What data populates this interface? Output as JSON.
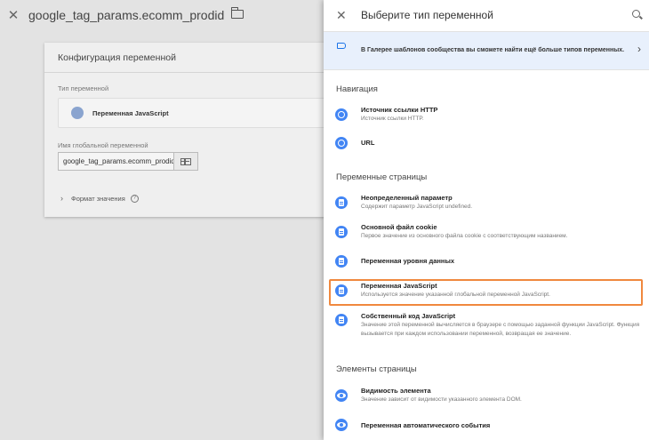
{
  "editor": {
    "title": "google_tag_params.ecomm_prodid",
    "card_title": "Конфигурация переменной",
    "type_label": "Тип переменной",
    "type_value": "Переменная JavaScript",
    "global_var_label": "Имя глобальной переменной",
    "global_var_value": "google_tag_params.ecomm_prodid",
    "format_label": "Формат значения",
    "help_glyph": "?"
  },
  "panel": {
    "title": "Выберите тип переменной",
    "promo": "В Галерее шаблонов сообщества вы сможете найти ещё больше типов переменных.",
    "sections": {
      "navigation": "Навигация",
      "page_vars": "Переменные страницы",
      "page_elements": "Элементы страницы"
    },
    "items": {
      "referrer_title": "Источник ссылки HTTP",
      "referrer_desc": "Источник ссылки HTTP.",
      "url_title": "URL",
      "undefined_title": "Неопределенный параметр",
      "undefined_desc": "Содержит параметр JavaScript undefined.",
      "cookie_title": "Основной файл cookie",
      "cookie_desc": "Первое значение из основного файла cookie с соответствующим названием.",
      "datalayer_title": "Переменная уровня данных",
      "jsvar_title": "Переменная JavaScript",
      "jsvar_desc": "Используется значение указанной глобальной переменной JavaScript.",
      "customjs_title": "Собственный код JavaScript",
      "customjs_desc": "Значение этой переменной вычисляется в браузере с помощью заданной функции JavaScript. Функция вызывается при каждом использовании переменной, возвращая ее значение.",
      "visibility_title": "Видимость элемента",
      "visibility_desc": "Значение зависит от видимости указанного элемента DOM.",
      "autoevent_title": "Переменная автоматического события"
    }
  },
  "colors": {
    "accent": "#4285f4",
    "highlight": "#f0883e",
    "promo_bg": "#e8f0fc"
  }
}
